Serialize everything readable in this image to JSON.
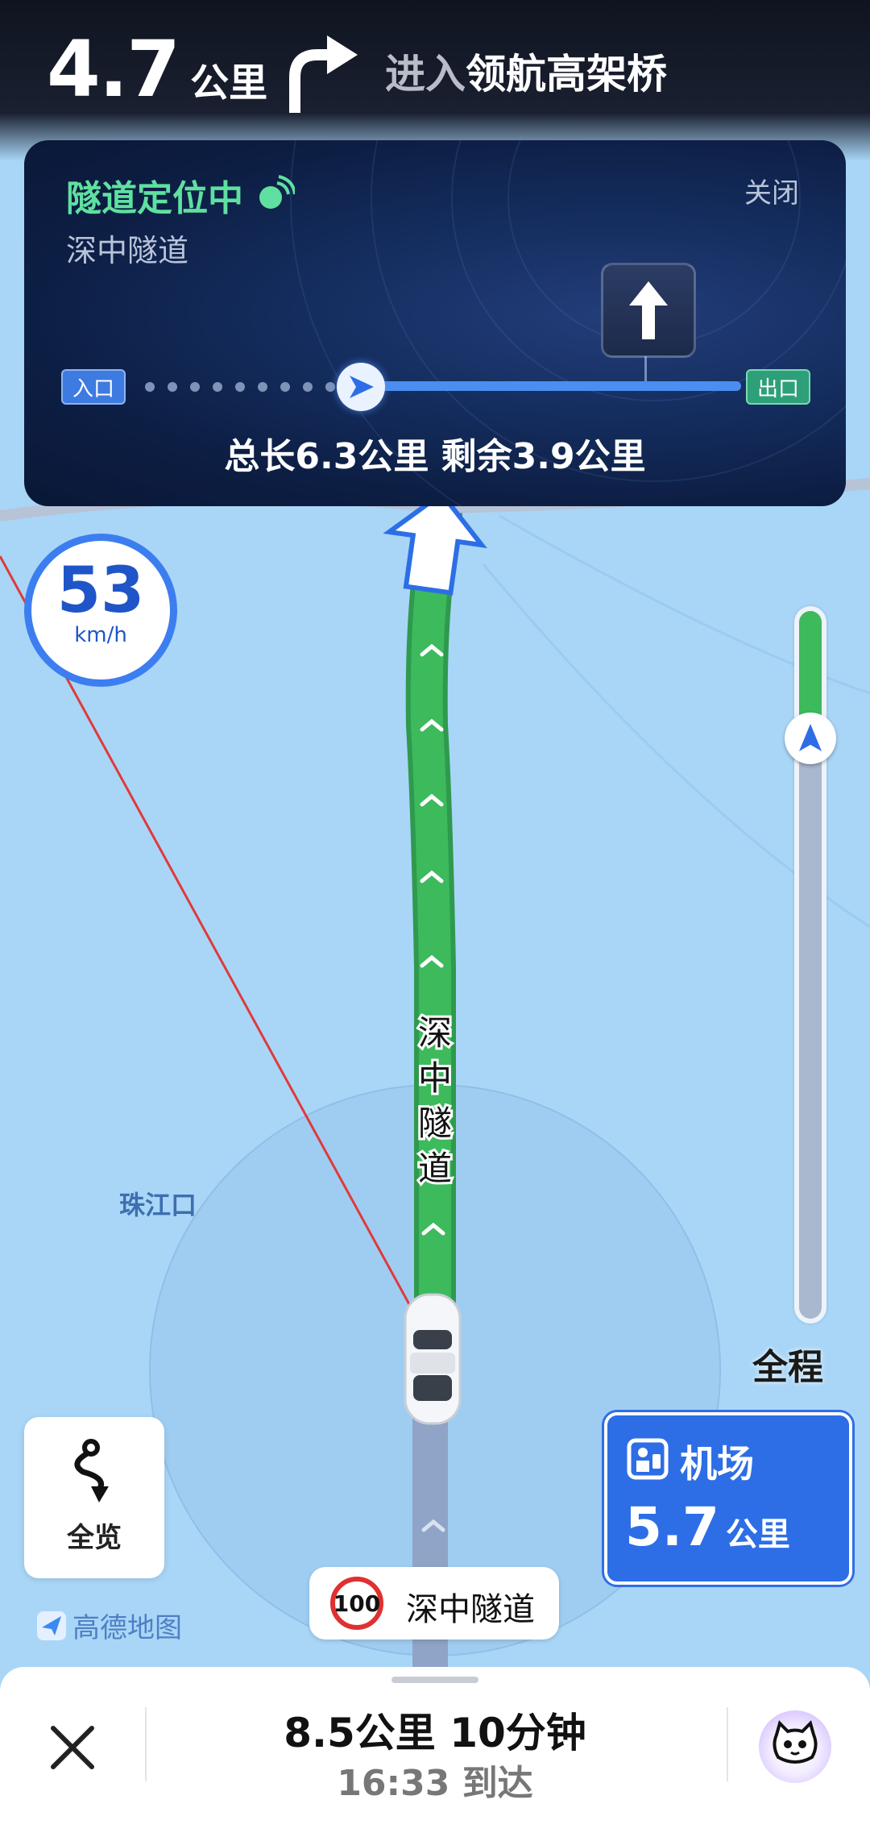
{
  "nav": {
    "distance_value": "4.7",
    "distance_unit": "公里",
    "action_prefix": "进入",
    "road_name": "领航高架桥"
  },
  "tunnel_panel": {
    "status": "隧道定位中",
    "tunnel_name": "深中隧道",
    "close_label": "关闭",
    "entry_label": "入口",
    "exit_label": "出口",
    "summary": "总长6.3公里 剩余3.9公里",
    "progress_fraction": 0.38
  },
  "speed": {
    "value": "53",
    "unit": "km/h"
  },
  "route_progress": {
    "label": "全程",
    "fraction": 0.18
  },
  "map": {
    "road_label": "深中隧道",
    "place_label": "珠江口",
    "speed_limit": "100",
    "current_road": "深中隧道",
    "brand": "高德地图"
  },
  "overview": {
    "label": "全览"
  },
  "destination_sign": {
    "name": "机场",
    "distance": "5.7",
    "unit": "公里"
  },
  "trip": {
    "summary": "8.5公里 10分钟",
    "eta": "16:33 到达"
  },
  "colors": {
    "route_green": "#3dba5c",
    "accent_blue": "#2d6ee6",
    "tunnel_green": "#5fe0a0"
  }
}
